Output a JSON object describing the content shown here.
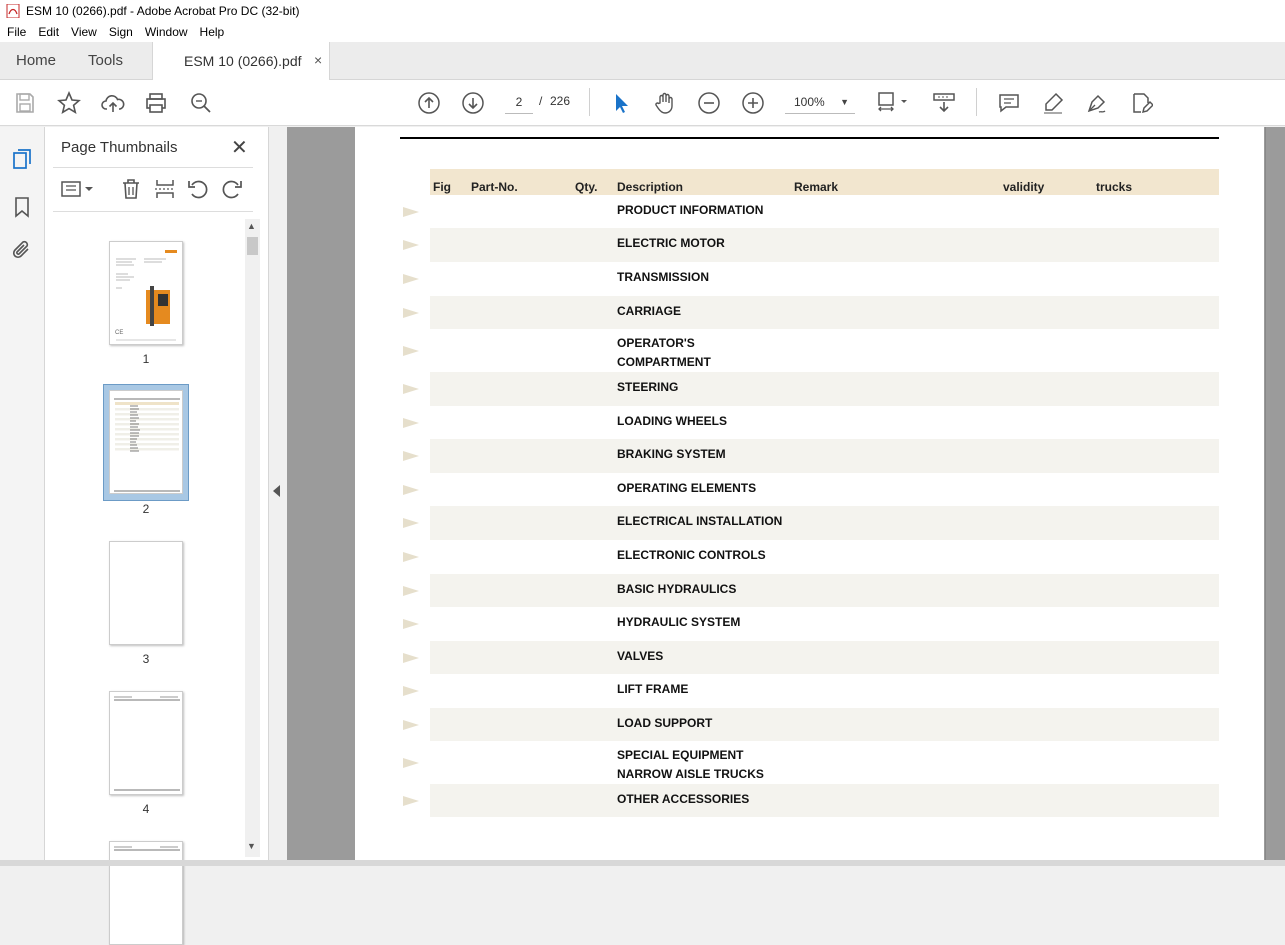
{
  "window": {
    "title": "ESM 10 (0266).pdf - Adobe Acrobat Pro DC (32-bit)"
  },
  "menu": [
    "File",
    "Edit",
    "View",
    "Sign",
    "Window",
    "Help"
  ],
  "tabs": {
    "home": "Home",
    "tools": "Tools",
    "document": "ESM 10 (0266).pdf",
    "close": "×"
  },
  "toolbar": {
    "current_page": "2",
    "separator": "/",
    "total_pages": "226",
    "zoom": "100%"
  },
  "thumbnails": {
    "title": "Page Thumbnails",
    "close": "✕",
    "pages": [
      {
        "number": "1"
      },
      {
        "number": "2"
      },
      {
        "number": "3"
      },
      {
        "number": "4"
      }
    ]
  },
  "document": {
    "columns": {
      "fig": "Fig",
      "part_no": "Part-No.",
      "qty": "Qty.",
      "description": "Description",
      "remark": "Remark",
      "validity": "validity",
      "trucks": "trucks"
    },
    "rows": [
      "PRODUCT INFORMATION",
      "ELECTRIC MOTOR",
      "TRANSMISSION",
      "CARRIAGE",
      "OPERATOR'S\nCOMPARTMENT",
      "STEERING",
      "LOADING WHEELS",
      "BRAKING SYSTEM",
      "OPERATING ELEMENTS",
      "ELECTRICAL INSTALLATION",
      "ELECTRONIC CONTROLS",
      "BASIC HYDRAULICS",
      "HYDRAULIC SYSTEM",
      "VALVES",
      "LIFT FRAME",
      "LOAD SUPPORT",
      "SPECIAL EQUIPMENT\nNARROW AISLE TRUCKS",
      "OTHER ACCESSORIES"
    ]
  },
  "colors": {
    "header_bg": "#f2e6cf",
    "shaded_row": "#f4f3ee",
    "accent_blue": "#1a73c9",
    "selected_thumb": "#a9c8e4"
  }
}
